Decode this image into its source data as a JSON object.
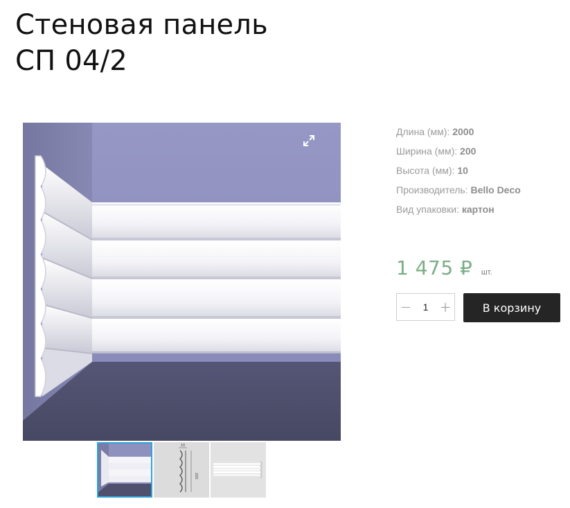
{
  "product": {
    "title_line1": "Стеновая панель",
    "title_line2": "СП 04/2"
  },
  "specs": [
    {
      "label": "Длина (мм):",
      "value": "2000"
    },
    {
      "label": "Ширина (мм):",
      "value": "200"
    },
    {
      "label": "Высота (мм):",
      "value": "10"
    },
    {
      "label": "Производитель:",
      "value": "Bello Deco"
    },
    {
      "label": "Вид упаковки:",
      "value": "картон"
    }
  ],
  "price": {
    "amount": "1 475 ₽",
    "unit": "шт."
  },
  "quantity": {
    "value": "1",
    "minus_symbol": "−",
    "plus_symbol": "+"
  },
  "cart": {
    "button_label": "В корзину"
  },
  "thumbnail_labels": {
    "width": "10",
    "height": "200"
  },
  "gallery": {
    "expand_icon": "expand-icon",
    "thumbnail_count": 3,
    "active_thumbnail": 1
  },
  "colors": {
    "price": "#7aae84",
    "cart_button": "#252525",
    "thumb_active_border": "#2ba5dc",
    "wall": "#8e90bd",
    "floor": "#4f506d"
  }
}
